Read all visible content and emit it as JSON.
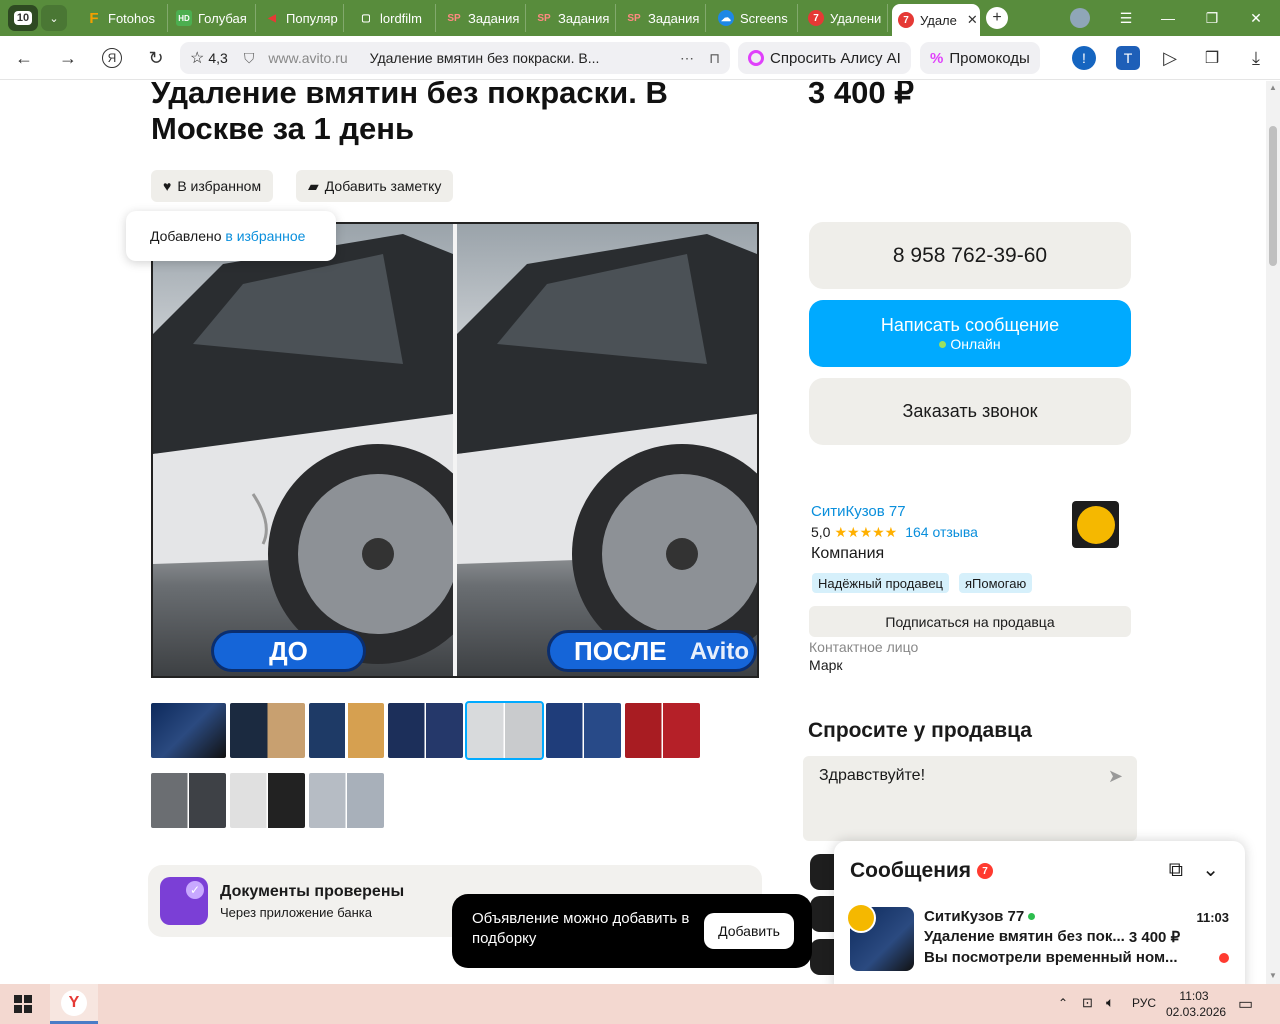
{
  "browser": {
    "tab_count": "10",
    "tabs": [
      {
        "label": "Fotohos",
        "icon": "F"
      },
      {
        "label": "Голубая",
        "icon": "HD"
      },
      {
        "label": "Популяр",
        "icon": "◀"
      },
      {
        "label": "lordfilm",
        "icon": "▢"
      },
      {
        "label": "Задания",
        "icon": "SP"
      },
      {
        "label": "Задания",
        "icon": "SP"
      },
      {
        "label": "Задания",
        "icon": "SP"
      },
      {
        "label": "Screens",
        "icon": "☁"
      },
      {
        "label": "Удалени",
        "icon": "7"
      },
      {
        "label": "Удале",
        "icon": "7"
      }
    ],
    "rating": "4,3",
    "url": "www.avito.ru",
    "page_title": "Удаление вмятин без покраски. В...",
    "alice": "Спросить Алису AI",
    "promo": "Промокоды"
  },
  "listing": {
    "title": "Удаление вмятин без покраски. В Москве за 1 день",
    "price": "3 400 ₽",
    "fav_label": "В избранном",
    "note_label": "Добавить заметку",
    "toast_prefix": "Добавлено ",
    "toast_link": "в избранное",
    "before_label": "ДО",
    "after_label": "ПОСЛЕ",
    "watermark": "Avito",
    "docs_title": "Документы проверены",
    "docs_sub": "Через приложение банка"
  },
  "contact": {
    "phone": "8 958 762-39-60",
    "message_btn": "Написать сообщение",
    "online": "Онлайн",
    "call_btn": "Заказать звонок"
  },
  "seller": {
    "name": "СитиКузов 77",
    "rating": "5,0",
    "stars": "★★★★★",
    "reviews": "164 отзыва",
    "type": "Компания",
    "badge1": "Надёжный продавец",
    "badge2": "яПомогаю",
    "subscribe": "Подписаться на продавца",
    "contact_label": "Контактное лицо",
    "contact_name": "Марк"
  },
  "ask": {
    "title": "Спросите у продавца",
    "input_value": "Здравствуйте!"
  },
  "toast2": {
    "text": "Объявление можно добавить в подборку",
    "button": "Добавить"
  },
  "messages": {
    "title": "Сообщения",
    "count": "7",
    "chat_name": "СитиКузов 77",
    "chat_time": "11:03",
    "chat_subject": "Удаление вмятин без пок...",
    "chat_price": "3 400 ₽",
    "chat_preview": "Вы посмотрели временный ном..."
  },
  "taskbar": {
    "lang": "РУС",
    "time": "11:03",
    "date": "02.03.2026"
  },
  "colors": {
    "accent": "#00aaff",
    "tabbar": "#588c3c",
    "taskbar": "#f3d8d0"
  }
}
